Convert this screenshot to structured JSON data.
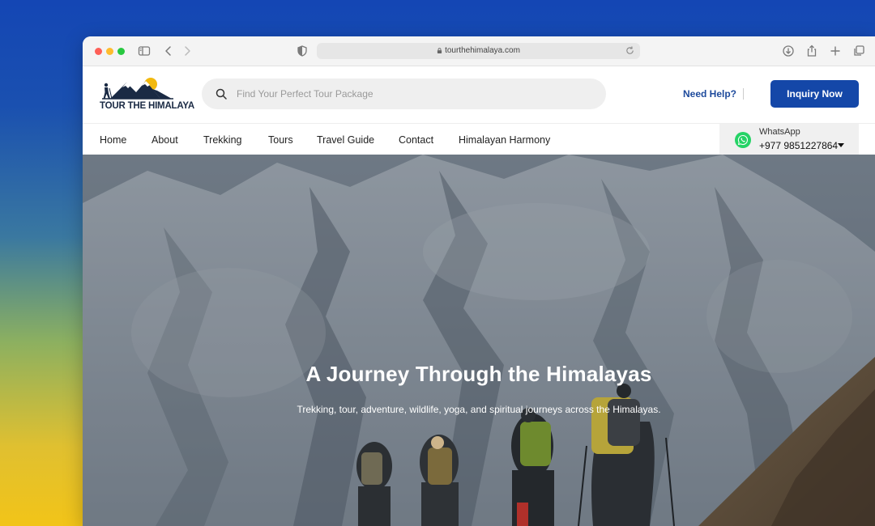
{
  "browser": {
    "url": "tourthehimalaya.com"
  },
  "header": {
    "logo_text": "TOUR THE HIMALAYA",
    "search_placeholder": "Find Your Perfect Tour Package",
    "need_help": "Need Help?",
    "inquiry_label": "Inquiry Now"
  },
  "nav": {
    "items": [
      {
        "label": "Home"
      },
      {
        "label": "About"
      },
      {
        "label": "Trekking"
      },
      {
        "label": "Tours"
      },
      {
        "label": "Travel Guide"
      },
      {
        "label": "Contact"
      },
      {
        "label": "Himalayan Harmony"
      }
    ],
    "whatsapp": {
      "label": "WhatsApp",
      "phone": "+977 9851227864"
    }
  },
  "hero": {
    "title": "A Journey Through the Himalayas",
    "subtitle": "Trekking, tour, adventure, wildlife, yoga, and spiritual journeys across the Himalayas."
  },
  "colors": {
    "brand_blue": "#1447a8",
    "link_blue": "#1d4a9c",
    "whatsapp_green": "#25d366"
  }
}
